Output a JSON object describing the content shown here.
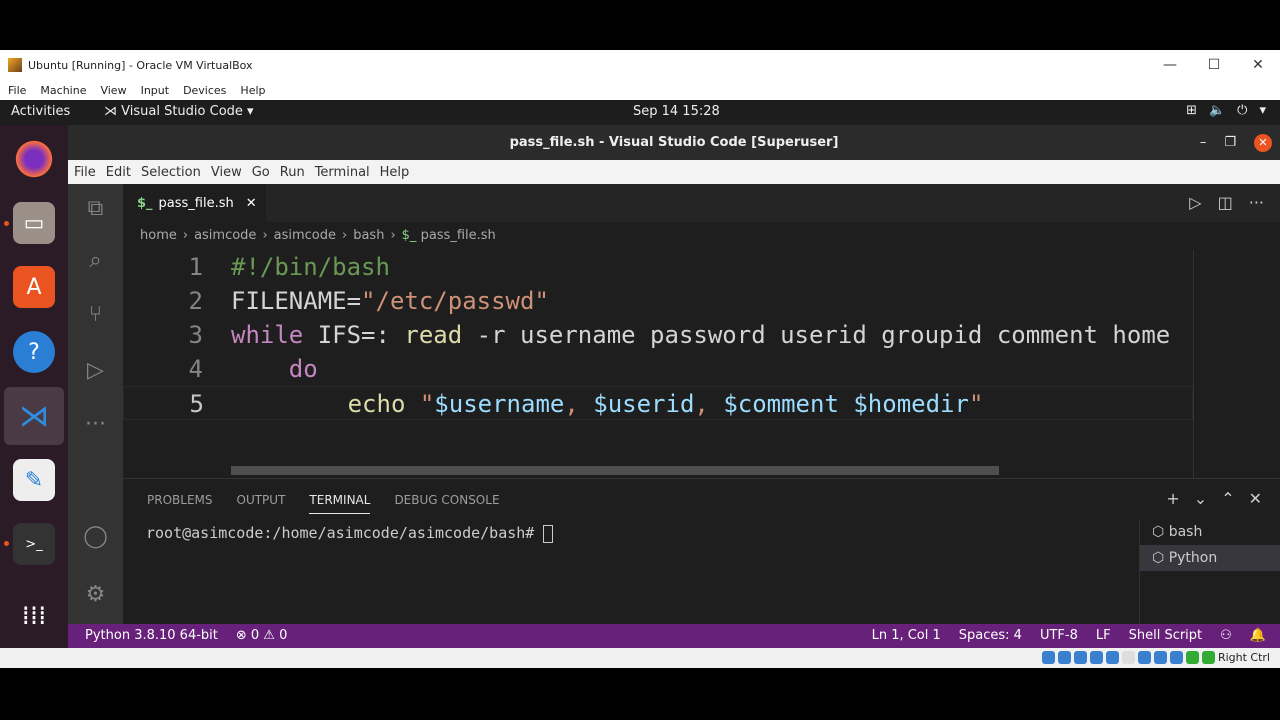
{
  "vbox": {
    "title": "Ubuntu [Running] - Oracle VM VirtualBox",
    "menu": [
      "File",
      "Machine",
      "View",
      "Input",
      "Devices",
      "Help"
    ],
    "host_key": "Right Ctrl"
  },
  "gnome": {
    "activities": "Activities",
    "app": "Visual Studio Code ▾",
    "clock": "Sep 14  15:28"
  },
  "vscode": {
    "title": "pass_file.sh - Visual Studio Code [Superuser]",
    "menu": [
      "File",
      "Edit",
      "Selection",
      "View",
      "Go",
      "Run",
      "Terminal",
      "Help"
    ],
    "tab": {
      "icon": "$_",
      "label": "pass_file.sh"
    },
    "breadcrumb": [
      "home",
      "asimcode",
      "asimcode",
      "bash",
      "pass_file.sh"
    ],
    "lines": [
      {
        "n": "1",
        "tokens": [
          [
            "c",
            "#!/bin/bash"
          ]
        ]
      },
      {
        "n": "2",
        "tokens": [
          [
            "p",
            "FILENAME="
          ],
          [
            "s",
            "\"/etc/passwd\""
          ]
        ]
      },
      {
        "n": "3",
        "tokens": [
          [
            "k",
            "while"
          ],
          [
            "p",
            " IFS=: "
          ],
          [
            "f",
            "read"
          ],
          [
            "p",
            " -r username password userid groupid comment home"
          ]
        ]
      },
      {
        "n": "4",
        "tokens": [
          [
            "p",
            "    "
          ],
          [
            "k",
            "do"
          ]
        ]
      },
      {
        "n": "5",
        "tokens": [
          [
            "p",
            "        "
          ],
          [
            "f",
            "echo"
          ],
          [
            "s",
            " \""
          ],
          [
            "v",
            "$username"
          ],
          [
            "s",
            ", "
          ],
          [
            "v",
            "$userid"
          ],
          [
            "s",
            ", "
          ],
          [
            "v",
            "$comment"
          ],
          [
            "s",
            " "
          ],
          [
            "v",
            "$homedir"
          ],
          [
            "s",
            "\""
          ]
        ]
      }
    ],
    "panel": {
      "tabs": [
        "PROBLEMS",
        "OUTPUT",
        "TERMINAL",
        "DEBUG CONSOLE"
      ],
      "active": "TERMINAL",
      "prompt": "root@asimcode:/home/asimcode/asimcode/bash# ",
      "terminals": [
        "bash",
        "Python"
      ]
    },
    "status": {
      "python": "Python 3.8.10 64-bit",
      "problems": "⊗ 0 ⚠ 0",
      "position": "Ln 1, Col 1",
      "spaces": "Spaces: 4",
      "encoding": "UTF-8",
      "eol": "LF",
      "language": "Shell Script"
    }
  },
  "colors": {
    "status_bar": "#68217a",
    "dock": "#2b1b27",
    "editor_bg": "#1e1e1e"
  }
}
